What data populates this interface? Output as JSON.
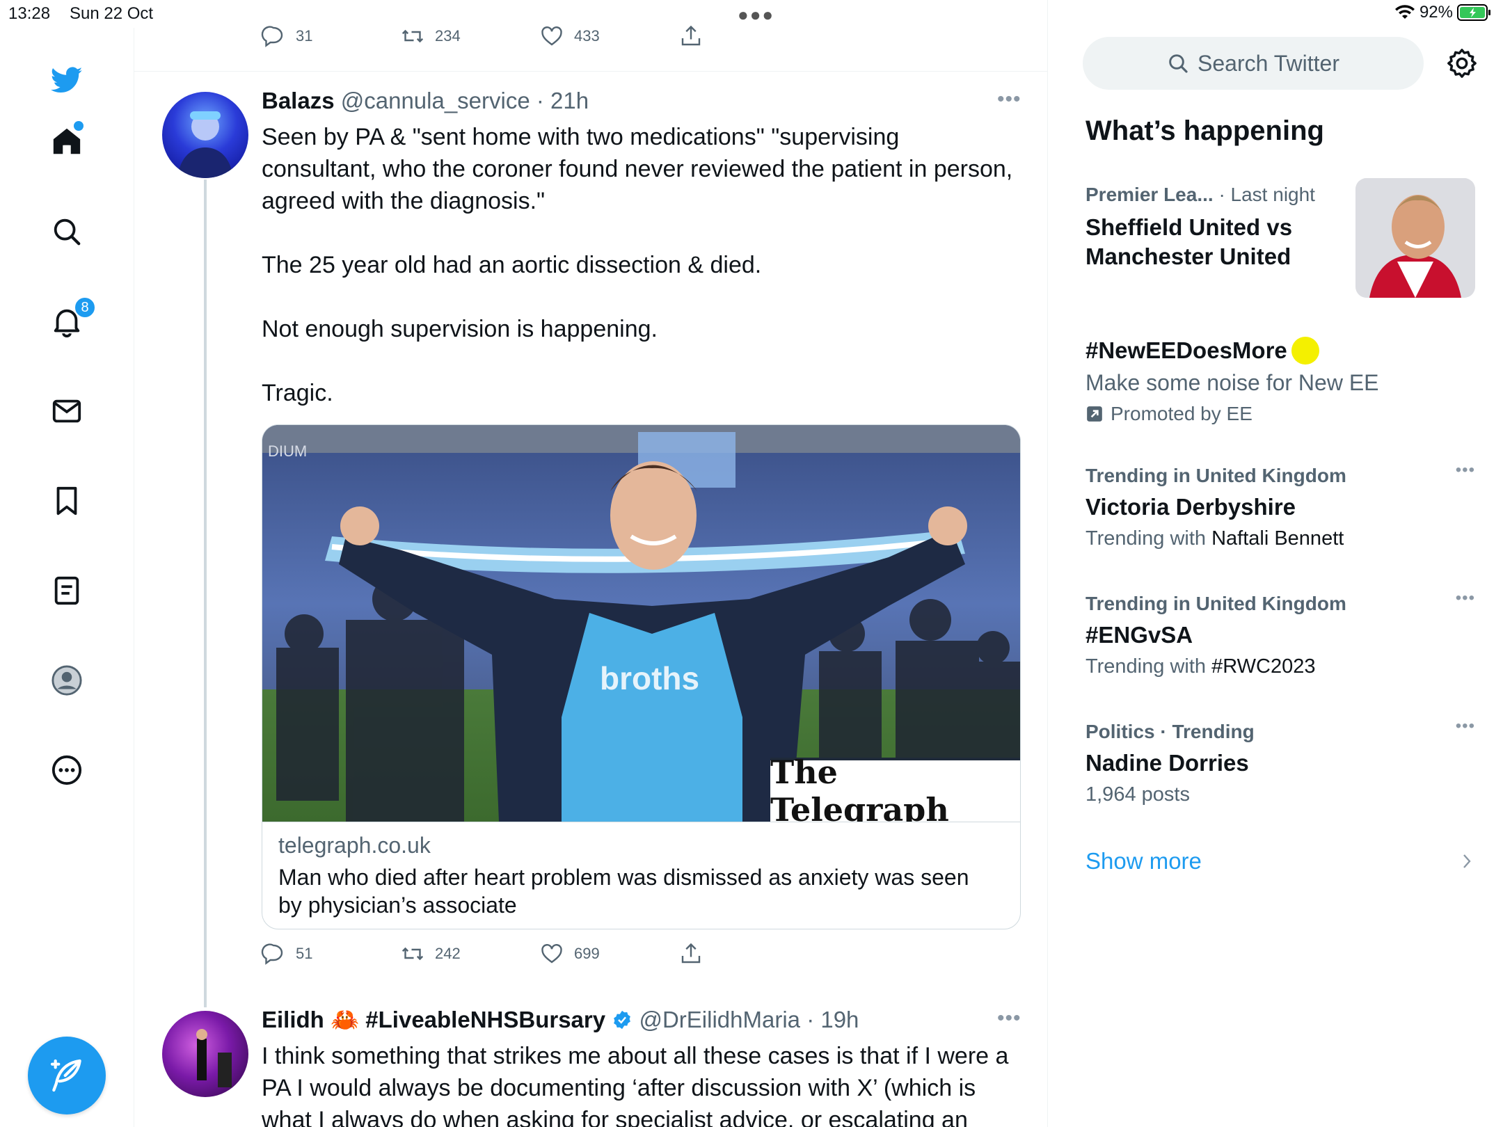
{
  "status_bar": {
    "time": "13:28",
    "date": "Sun 22 Oct",
    "battery": "92%"
  },
  "nav": {
    "notification_count": "8"
  },
  "top_tweet_actions": {
    "replies": "31",
    "retweets": "234",
    "likes": "433"
  },
  "tweet1": {
    "name": "Balazs",
    "handle": "@cannula_service",
    "time": "· 21h",
    "text": "Seen by PA & \"sent home with two medications\" \"supervising consultant, who the coroner found never reviewed the patient in person, agreed with the diagnosis.\"\n\nThe 25 year old had an aortic dissection & died.\n\nNot enough supervision is happening.\n\nTragic.",
    "card": {
      "overlay_brand": "The Telegraph",
      "stadium_text": "DIUM",
      "shirt_text": "broths",
      "domain": "telegraph.co.uk",
      "title": "Man who died after heart problem was dismissed as anxiety was seen by physician’s associate"
    },
    "actions": {
      "replies": "51",
      "retweets": "242",
      "likes": "699"
    }
  },
  "tweet2": {
    "name": "Eilidh",
    "emoji": "🦀",
    "tag": "#LiveableNHSBursary",
    "handle": "@DrEilidhMaria",
    "time": "· 19h",
    "text": "I think something that strikes me about all these cases is that if I were a PA I would always be documenting ‘after discussion with X’ (which is what I always do when asking for specialist advice, or escalating an"
  },
  "sidebar": {
    "search_placeholder": "Search Twitter",
    "heading": "What’s happening",
    "trends": [
      {
        "meta": "Premier Lea...",
        "meta_time": "· Last night",
        "title": "Sheffield United vs Manchester United"
      },
      {
        "title": "#NewEEDoesMore",
        "sub": "Make some noise for New EE",
        "promoted": "Promoted by EE"
      },
      {
        "meta": "Trending in United Kingdom",
        "title": "Victoria Derbyshire",
        "sub_prefix": "Trending with ",
        "sub_value": "Naftali Bennett"
      },
      {
        "meta": "Trending in United Kingdom",
        "title": "#ENGvSA",
        "sub_prefix": "Trending with ",
        "sub_value": "#RWC2023"
      },
      {
        "meta": "Politics · Trending",
        "title": "Nadine Dorries",
        "sub": "1,964 posts"
      }
    ],
    "show_more": "Show more"
  },
  "colors": {
    "accent": "#1d9bf0",
    "text": "#0f1419",
    "secondary": "#536471",
    "promo_dot": "#f4f000",
    "battery": "#34c759"
  }
}
